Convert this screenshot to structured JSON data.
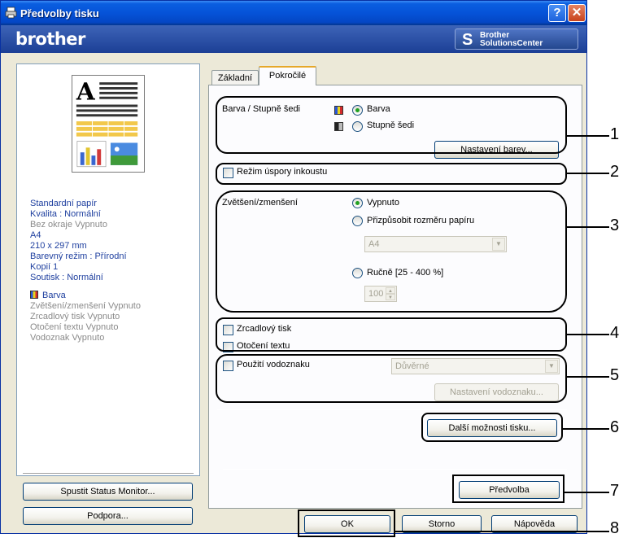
{
  "window": {
    "title": "Předvolby tisku",
    "help_glyph": "?",
    "close_glyph": "✕"
  },
  "banner": {
    "brand": "brother",
    "solutions_line1": "Brother",
    "solutions_line2": "SolutionsCenter"
  },
  "tabs": [
    {
      "label": "Základní"
    },
    {
      "label": "Pokročilé"
    }
  ],
  "summary": {
    "lines_blue": [
      "Standardní papír",
      "Kvalita : Normální"
    ],
    "line_gray": "Bez okraje Vypnuto",
    "lines_blue2": [
      "A4",
      "210 x 297 mm",
      "Barevný režim : Přírodní",
      "Kopií 1",
      "Soutisk : Normální"
    ],
    "color_label": "Barva",
    "lines_gray2": [
      "Zvětšení/zmenšení Vypnuto",
      "Zrcadlový tisk Vypnuto",
      "Otočení textu Vypnuto",
      "Vodoznak Vypnuto"
    ]
  },
  "left_buttons": {
    "status_monitor": "Spustit Status Monitor...",
    "support": "Podpora..."
  },
  "color_section": {
    "label": "Barva / Stupně šedi",
    "option_color": "Barva",
    "option_gray": "Stupně šedi",
    "settings_button": "Nastavení barev..."
  },
  "ink_save": {
    "label": "Režim úspory inkoustu"
  },
  "scaling": {
    "label": "Zvětšení/zmenšení",
    "option_off": "Vypnuto",
    "option_fit": "Přizpůsobit rozměru papíru",
    "paper_value": "A4",
    "option_manual": "Ručně [25 - 400 %]",
    "manual_value": "100",
    "arrow_down": "▼",
    "arrow_up": "▲"
  },
  "mirror": {
    "label": "Zrcadlový tisk"
  },
  "rotate": {
    "label": "Otočení textu"
  },
  "watermark": {
    "label": "Použití vodoznaku",
    "value": "Důvěrné",
    "settings_button": "Nastavení vodoznaku..."
  },
  "more_options_button": "Další možnosti tisku...",
  "default_button": "Předvolba",
  "dialog_buttons": {
    "ok": "OK",
    "cancel": "Storno",
    "help": "Nápověda"
  },
  "callouts": [
    "1",
    "2",
    "3",
    "4",
    "5",
    "6",
    "7",
    "8"
  ],
  "colors": {
    "title_bar": "#0553d8",
    "banner": "#2a4da2",
    "dialog_bg": "#ece9d8",
    "summary_text": "#1e3f9f"
  }
}
